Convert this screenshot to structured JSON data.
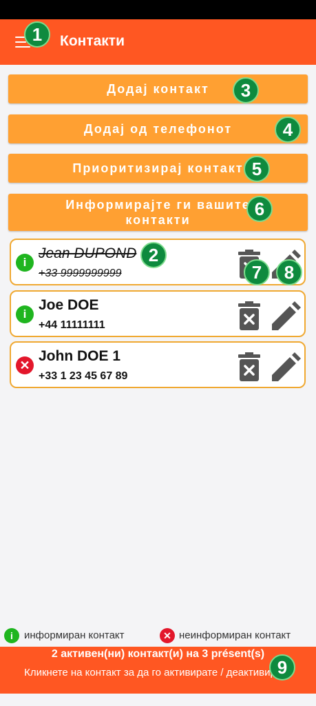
{
  "header": {
    "title": "Контакти"
  },
  "buttons": {
    "add_contact": "Додај контакт",
    "add_from_phone": "Додај од телефонот",
    "prioritize": "Приоритизирај контакт",
    "inform": "Информирајте ги вашите контакти"
  },
  "contacts": [
    {
      "name": "Jean DUPOND",
      "phone": "+33 9999999999",
      "status": "informed",
      "struck": true
    },
    {
      "name": "Joe DOE",
      "phone": "+44 11111111",
      "status": "informed",
      "struck": false
    },
    {
      "name": "John DOE 1",
      "phone": "+33 1 23 45 67 89",
      "status": "not-informed",
      "struck": false
    }
  ],
  "legend": {
    "informed": "информиран контакт",
    "not_informed": "неинформиран контакт"
  },
  "footer": {
    "line1": "2 активен(ни) контакт(и) на 3 présent(s)",
    "line2": "Кликнете на контакт за да го активирате / деактивирате"
  },
  "markers": [
    "1",
    "2",
    "3",
    "4",
    "5",
    "6",
    "7",
    "8",
    "9"
  ],
  "colors": {
    "appbar": "#ff5722",
    "button": "#ffa032",
    "card_border": "#f0a830",
    "informed": "#1fb51f",
    "not_informed": "#e3172b",
    "marker": "#0e8a3e"
  }
}
